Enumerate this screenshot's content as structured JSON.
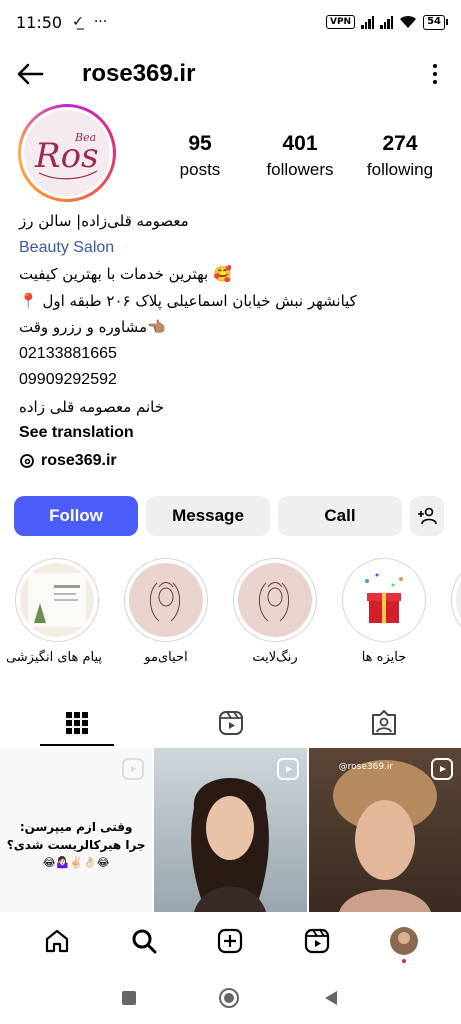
{
  "status_bar": {
    "time": "11:50",
    "vpn": "VPN",
    "battery": "54"
  },
  "header": {
    "username": "rose369.ir"
  },
  "profile": {
    "avatar_text": "Ros",
    "avatar_sub": "Bea",
    "stats": [
      {
        "value": "95",
        "label": "posts"
      },
      {
        "value": "401",
        "label": "followers"
      },
      {
        "value": "274",
        "label": "following"
      }
    ],
    "bio": {
      "name": "معصومه قلی‌زاده| سالن رز",
      "category": "Beauty Salon",
      "line1": "🥰 بهترین خدمات با بهترین کیفیت",
      "line2": "کیانشهر نبش خیابان اسماعیلی پلاک ۲۰۶ طبقه اول 📍",
      "line3": "👈🏽مشاوره و رزرو وقت",
      "phone1": "02133881665",
      "phone2": "09909292592",
      "line4": "خانم معصومه قلی زاده",
      "see_translation": "See translation"
    },
    "threads_handle": "rose369.ir"
  },
  "buttons": {
    "follow": "Follow",
    "message": "Message",
    "call": "Call"
  },
  "highlights": [
    {
      "label": "پیام های انگیزشی"
    },
    {
      "label": "احیای‌مو"
    },
    {
      "label": "رنگ‌لایت"
    },
    {
      "label": "جایزه ها"
    }
  ],
  "grid": {
    "post1_caption_line1": "وقتی ازم میپرسن:",
    "post1_caption_line2": "جرا هیرکالریست شدی؟",
    "post1_emojis": "😂👌🏻✌🏻🤷🏻‍♀️😂",
    "post3_watermark": "@rose369.ir"
  },
  "colors": {
    "follow_blue": "#4a5df9",
    "category_blue": "#3b57a4",
    "button_grey": "#efefef"
  },
  "icons": [
    "back-arrow-icon",
    "more-icon",
    "threads-icon",
    "add-person-icon",
    "grid-icon",
    "reels-icon",
    "tagged-icon",
    "home-icon",
    "search-icon",
    "create-icon",
    "reels-nav-icon",
    "profile-avatar-icon"
  ]
}
